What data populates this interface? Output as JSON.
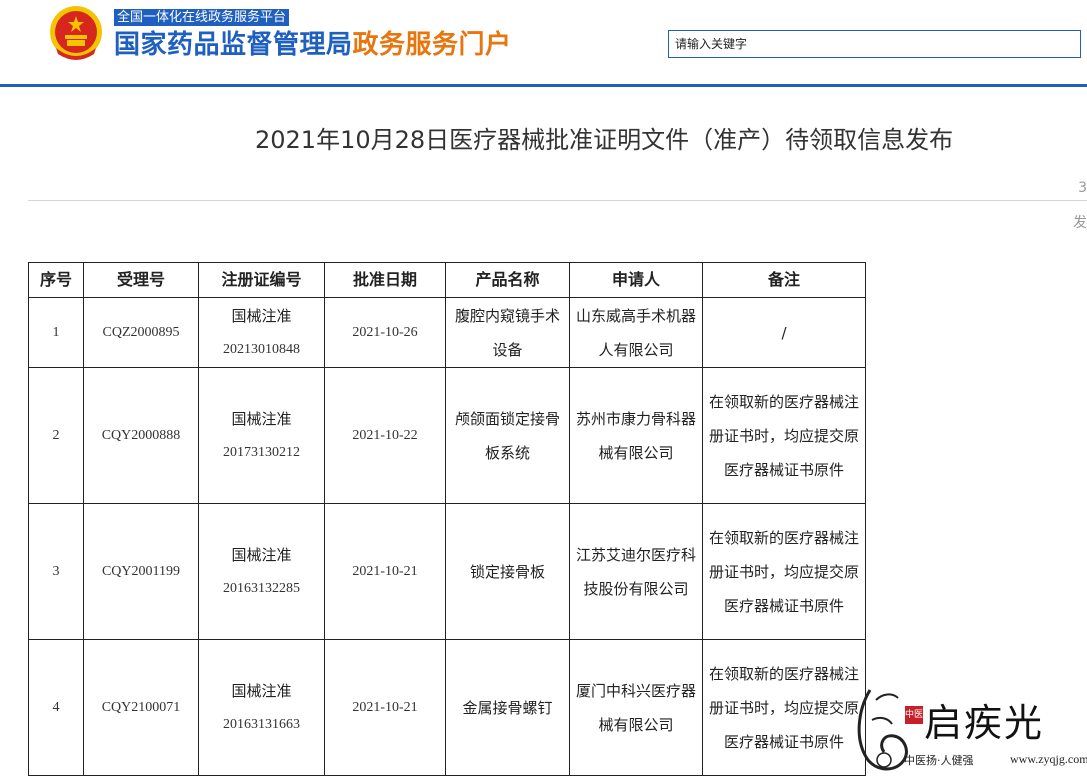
{
  "header": {
    "platform_tag": "全国一体化在线政务服务平台",
    "title_main": "国家药品监督管理局",
    "title_highlight": "政务服务门户",
    "search_placeholder": "请输入关键字"
  },
  "article": {
    "title": "2021年10月28日医疗器械批准证明文件（准产）待领取信息发布",
    "edge_marks": [
      "3",
      "发"
    ]
  },
  "table": {
    "headers": [
      "序号",
      "受理号",
      "注册证编号",
      "批准日期",
      "产品名称",
      "申请人",
      "备注"
    ],
    "rows": [
      {
        "no": "1",
        "accept_no": "CQZ2000895",
        "cert_prefix": "国械注准",
        "cert_no": "20213010848",
        "date": "2021-10-26",
        "product": "腹腔内窥镜手术设备",
        "applicant": "山东威高手术机器人有限公司",
        "remark": "/"
      },
      {
        "no": "2",
        "accept_no": "CQY2000888",
        "cert_prefix": "国械注准",
        "cert_no": "20173130212",
        "date": "2021-10-22",
        "product": "颅颌面锁定接骨板系统",
        "applicant": "苏州市康力骨科器械有限公司",
        "remark": "在领取新的医疗器械注册证书时，均应提交原医疗器械证书原件"
      },
      {
        "no": "3",
        "accept_no": "CQY2001199",
        "cert_prefix": "国械注准",
        "cert_no": "20163132285",
        "date": "2021-10-21",
        "product": "锁定接骨板",
        "applicant": "江苏艾迪尔医疗科技股份有限公司",
        "remark": "在领取新的医疗器械注册证书时，均应提交原医疗器械证书原件"
      },
      {
        "no": "4",
        "accept_no": "CQY2100071",
        "cert_prefix": "国械注准",
        "cert_no": "20163131663",
        "date": "2021-10-21",
        "product": "金属接骨螺钉",
        "applicant": "厦门中科兴医疗器械有限公司",
        "remark": "在领取新的医疗器械注册证书时，均应提交原医疗器械证书原件"
      }
    ]
  },
  "watermark": {
    "brand": "启疾光",
    "seal": "中医",
    "slogan": "中医扬·人健强",
    "url": "www.zyqjg.com"
  },
  "colors": {
    "brand_blue": "#1f5fbf",
    "brand_orange": "#e8760f",
    "emblem_red": "#d7261e",
    "emblem_gold": "#f5c400"
  }
}
